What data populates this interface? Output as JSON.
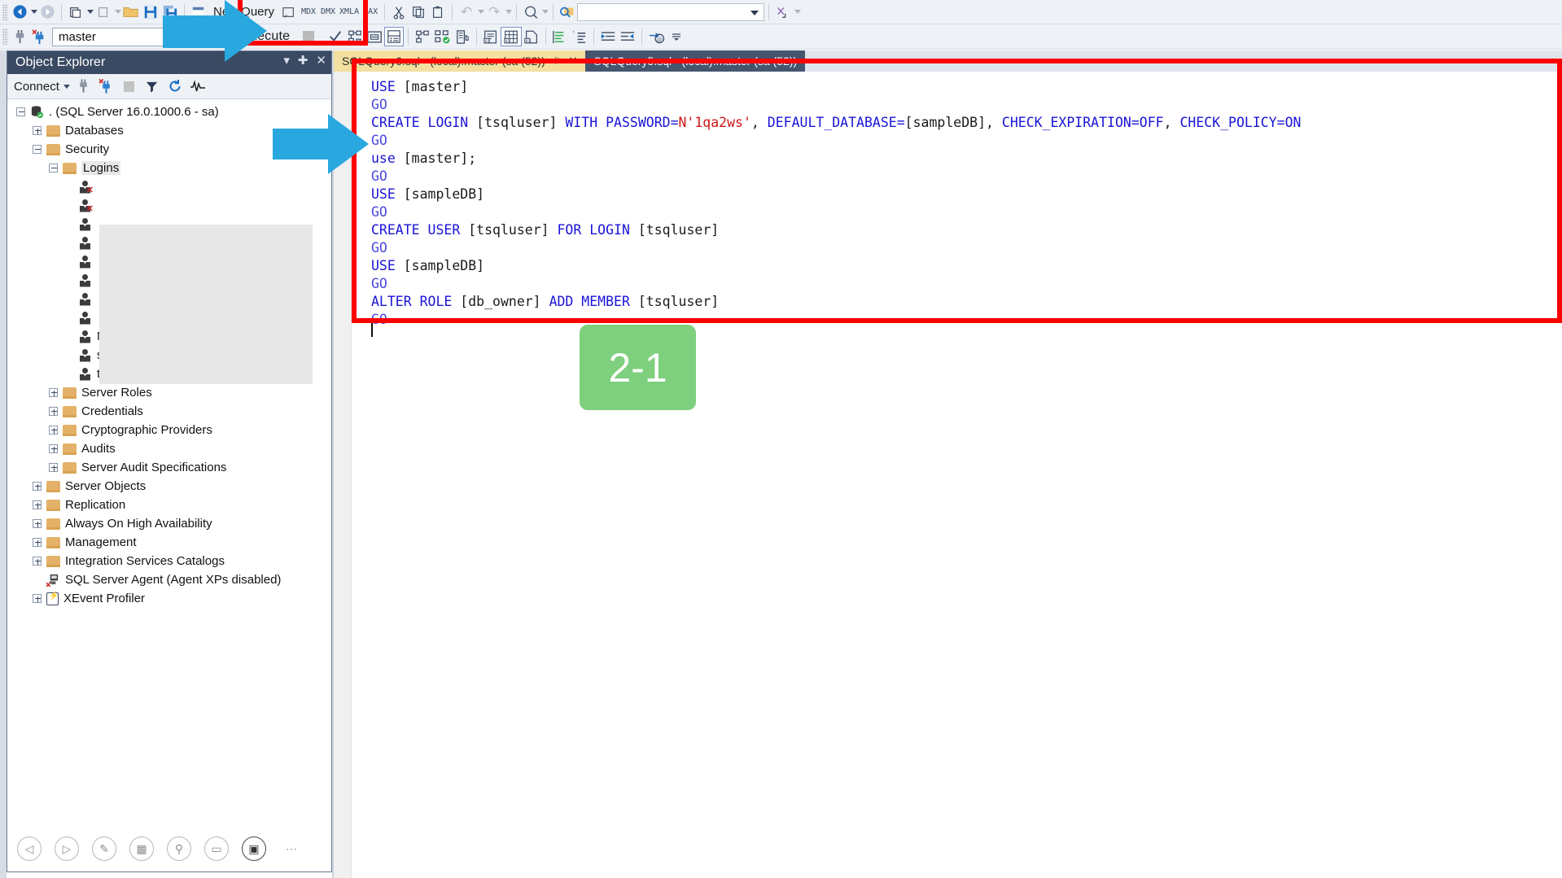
{
  "toolbar": {
    "row1": [
      {
        "name": "nav-back-icon",
        "glyph": "⮜"
      },
      {
        "name": "nav-back-dropdown-icon",
        "glyph": "▾"
      },
      {
        "name": "nav-forward-icon",
        "glyph": "⮞"
      },
      {
        "name": "new-project-icon",
        "glyph": "⧉"
      },
      {
        "name": "new-project-dropdown-icon",
        "glyph": "▾"
      },
      {
        "name": "new-item-icon",
        "glyph": "⎕"
      },
      {
        "name": "new-item-dropdown-icon",
        "glyph": "▾"
      },
      {
        "name": "open-file-icon",
        "glyph": "📁"
      },
      {
        "name": "save-icon",
        "glyph": "💾"
      },
      {
        "name": "save-all-icon",
        "glyph": "💾"
      },
      {
        "name": "new-query-icon",
        "glyph": "▤"
      },
      {
        "name": "new-query-label",
        "glyph": "New Query"
      },
      {
        "name": "database-engine-query-icon",
        "glyph": "⬚"
      },
      {
        "name": "analysis-services-mdx-query-icon",
        "glyph": "MDX"
      },
      {
        "name": "analysis-services-dmx-query-icon",
        "glyph": "DMX"
      },
      {
        "name": "analysis-services-xmla-query-icon",
        "glyph": "XMLA"
      },
      {
        "name": "analysis-services-dax-query-icon",
        "glyph": "DAX"
      },
      {
        "name": "cut-icon",
        "glyph": "✂"
      },
      {
        "name": "copy-icon",
        "glyph": "⧉"
      },
      {
        "name": "paste-icon",
        "glyph": "⎘"
      },
      {
        "name": "undo-icon",
        "glyph": "↶"
      },
      {
        "name": "undo-dropdown-icon",
        "glyph": "▾"
      },
      {
        "name": "redo-icon",
        "glyph": "↷"
      },
      {
        "name": "redo-dropdown-icon",
        "glyph": "▾"
      },
      {
        "name": "navigate-icon",
        "glyph": "⌾"
      },
      {
        "name": "navigate-dropdown-icon",
        "glyph": "▾"
      },
      {
        "name": "find-in-files-icon",
        "glyph": "🔍"
      },
      {
        "name": "quick-launch-input",
        "glyph": ""
      },
      {
        "name": "toolbox-icon",
        "glyph": "✄"
      }
    ],
    "row2": {
      "connection-plug-icon": "⬚",
      "connection-plug-new-icon": "⬚",
      "database_label": "master",
      "execute_label": "Execute",
      "stop_name": "stop-button",
      "debug_icon": "✓",
      "buttons": [
        {
          "name": "parse-query-icon"
        },
        {
          "name": "display-estimated-execution-plan-icon"
        },
        {
          "name": "query-options-icon"
        },
        {
          "name": "include-actual-execution-plan-icon"
        },
        {
          "name": "include-live-query-statistics-icon"
        },
        {
          "name": "include-client-statistics-icon"
        },
        {
          "name": "results-to-text-icon"
        },
        {
          "name": "results-to-grid-icon"
        },
        {
          "name": "results-to-file-icon"
        },
        {
          "name": "comment-out-lines-icon"
        },
        {
          "name": "uncomment-lines-icon"
        },
        {
          "name": "decrease-indent-icon"
        },
        {
          "name": "increase-indent-icon"
        },
        {
          "name": "specify-values-for-template-parameters-icon"
        },
        {
          "name": "toolbar-overflow-icon"
        }
      ]
    }
  },
  "object_explorer": {
    "title": "Object Explorer",
    "titlebar_icons": [
      {
        "name": "window-position-icon",
        "glyph": "▾"
      },
      {
        "name": "auto-hide-pin-icon",
        "glyph": "📌"
      },
      {
        "name": "close-panel-icon",
        "glyph": "✕"
      }
    ],
    "toolbar": {
      "connect_label": "Connect",
      "connect_caret": "▾",
      "icons": [
        {
          "name": "connect-object-explorer-icon"
        },
        {
          "name": "disconnect-object-explorer-icon"
        },
        {
          "name": "stop-action-icon"
        },
        {
          "name": "filter-icon"
        },
        {
          "name": "refresh-icon"
        },
        {
          "name": "activity-monitor-icon"
        }
      ]
    },
    "tree": [
      {
        "label": ". (SQL Server 16.0.1000.6 - sa)",
        "indent": 0,
        "toggle": "minus",
        "icon": "server-icon"
      },
      {
        "label": "Databases",
        "indent": 1,
        "toggle": "plus",
        "icon": "folder-icon"
      },
      {
        "label": "Security",
        "indent": 1,
        "toggle": "minus",
        "icon": "folder-icon"
      },
      {
        "label": "Logins",
        "indent": 2,
        "toggle": "minus",
        "icon": "folder-icon",
        "selected": true
      },
      {
        "label": "",
        "indent": 3,
        "toggle": "none",
        "icon": "login-disabled-icon"
      },
      {
        "label": "",
        "indent": 3,
        "toggle": "none",
        "icon": "login-disabled-icon"
      },
      {
        "label": "",
        "indent": 3,
        "toggle": "none",
        "icon": "login-icon"
      },
      {
        "label": "",
        "indent": 3,
        "toggle": "none",
        "icon": "login-icon"
      },
      {
        "label": "",
        "indent": 3,
        "toggle": "none",
        "icon": "login-icon"
      },
      {
        "label": "",
        "indent": 3,
        "toggle": "none",
        "icon": "login-icon"
      },
      {
        "label": "",
        "indent": 3,
        "toggle": "none",
        "icon": "login-icon"
      },
      {
        "label": "",
        "indent": 3,
        "toggle": "none",
        "icon": "login-icon"
      },
      {
        "label": "NT SERVICE\\Winmgmt",
        "indent": 3,
        "toggle": "none",
        "icon": "login-icon"
      },
      {
        "label": "sa",
        "indent": 3,
        "toggle": "none",
        "icon": "login-icon"
      },
      {
        "label": "testuser",
        "indent": 3,
        "toggle": "none",
        "icon": "login-icon"
      },
      {
        "label": "Server Roles",
        "indent": 2,
        "toggle": "plus",
        "icon": "folder-icon"
      },
      {
        "label": "Credentials",
        "indent": 2,
        "toggle": "plus",
        "icon": "folder-icon"
      },
      {
        "label": "Cryptographic Providers",
        "indent": 2,
        "toggle": "plus",
        "icon": "folder-icon"
      },
      {
        "label": "Audits",
        "indent": 2,
        "toggle": "plus",
        "icon": "folder-icon"
      },
      {
        "label": "Server Audit Specifications",
        "indent": 2,
        "toggle": "plus",
        "icon": "folder-icon"
      },
      {
        "label": "Server Objects",
        "indent": 1,
        "toggle": "plus",
        "icon": "folder-icon"
      },
      {
        "label": "Replication",
        "indent": 1,
        "toggle": "plus",
        "icon": "folder-icon"
      },
      {
        "label": "Always On High Availability",
        "indent": 1,
        "toggle": "plus",
        "icon": "folder-icon"
      },
      {
        "label": "Management",
        "indent": 1,
        "toggle": "plus",
        "icon": "folder-icon"
      },
      {
        "label": "Integration Services Catalogs",
        "indent": 1,
        "toggle": "plus",
        "icon": "folder-icon"
      },
      {
        "label": "SQL Server Agent (Agent XPs disabled)",
        "indent": 1,
        "toggle": "none",
        "icon": "sql-agent-disabled-icon"
      },
      {
        "label": "XEvent Profiler",
        "indent": 1,
        "toggle": "plus",
        "icon": "xevent-profiler-icon"
      }
    ],
    "footer_buttons": [
      {
        "name": "back-navigation-icon",
        "glyph": "◁"
      },
      {
        "name": "forward-navigation-icon",
        "glyph": "▷"
      },
      {
        "name": "edit-pencil-icon",
        "glyph": "✎"
      },
      {
        "name": "copy-frames-icon",
        "glyph": "▦"
      },
      {
        "name": "zoom-search-icon",
        "glyph": "⚲"
      },
      {
        "name": "screen-icon",
        "glyph": "▭"
      },
      {
        "name": "record-video-icon",
        "glyph": "▣",
        "active": true
      },
      {
        "name": "more-options-icon",
        "glyph": "⋯"
      }
    ]
  },
  "editor": {
    "tabs": [
      {
        "label": "SQLQuery6.sql - (local).master (sa (52))",
        "active": true,
        "pin": "⚐",
        "close": "✕"
      },
      {
        "label": "SQLQuery5.sql - (local).master (sa (52))",
        "active": false,
        "pin": "",
        "close": ""
      }
    ],
    "code_lines": [
      [
        {
          "t": "USE ",
          "c": "kw"
        },
        {
          "t": "[master]",
          "c": "plain"
        }
      ],
      [
        {
          "t": "GO",
          "c": "go"
        }
      ],
      [
        {
          "t": "CREATE LOGIN ",
          "c": "kw"
        },
        {
          "t": "[tsqluser] ",
          "c": "plain"
        },
        {
          "t": "WITH ",
          "c": "kw"
        },
        {
          "t": "PASSWORD=",
          "c": "kw"
        },
        {
          "t": "N'1qa2ws'",
          "c": "str"
        },
        {
          "t": ", ",
          "c": "plain"
        },
        {
          "t": "DEFAULT_DATABASE=",
          "c": "kw"
        },
        {
          "t": "[sampleDB]",
          "c": "plain"
        },
        {
          "t": ", ",
          "c": "plain"
        },
        {
          "t": "CHECK_EXPIRATION=OFF",
          "c": "kw"
        },
        {
          "t": ", ",
          "c": "plain"
        },
        {
          "t": "CHECK_POLICY=ON",
          "c": "kw"
        }
      ],
      [
        {
          "t": "GO",
          "c": "go"
        }
      ],
      [
        {
          "t": "use ",
          "c": "kw"
        },
        {
          "t": "[master];",
          "c": "plain"
        }
      ],
      [
        {
          "t": "GO",
          "c": "go"
        }
      ],
      [
        {
          "t": "USE ",
          "c": "kw"
        },
        {
          "t": "[sampleDB]",
          "c": "plain"
        }
      ],
      [
        {
          "t": "GO",
          "c": "go"
        }
      ],
      [
        {
          "t": "CREATE USER ",
          "c": "kw"
        },
        {
          "t": "[tsqluser] ",
          "c": "plain"
        },
        {
          "t": "FOR LOGIN ",
          "c": "kw"
        },
        {
          "t": "[tsqluser]",
          "c": "plain"
        }
      ],
      [
        {
          "t": "GO",
          "c": "go"
        }
      ],
      [
        {
          "t": "USE ",
          "c": "kw"
        },
        {
          "t": "[sampleDB]",
          "c": "plain"
        }
      ],
      [
        {
          "t": "GO",
          "c": "go"
        }
      ],
      [
        {
          "t": "ALTER ROLE ",
          "c": "kw"
        },
        {
          "t": "[db_owner] ",
          "c": "plain"
        },
        {
          "t": "ADD MEMBER ",
          "c": "kw"
        },
        {
          "t": "[tsqluser]",
          "c": "plain"
        }
      ],
      [
        {
          "t": "GO",
          "c": "go"
        }
      ]
    ]
  },
  "annotations": {
    "step_badge": "2-1",
    "badge_color": "#7ed07e",
    "highlight_color": "#ff0000",
    "arrow_color": "#29a8e0"
  }
}
